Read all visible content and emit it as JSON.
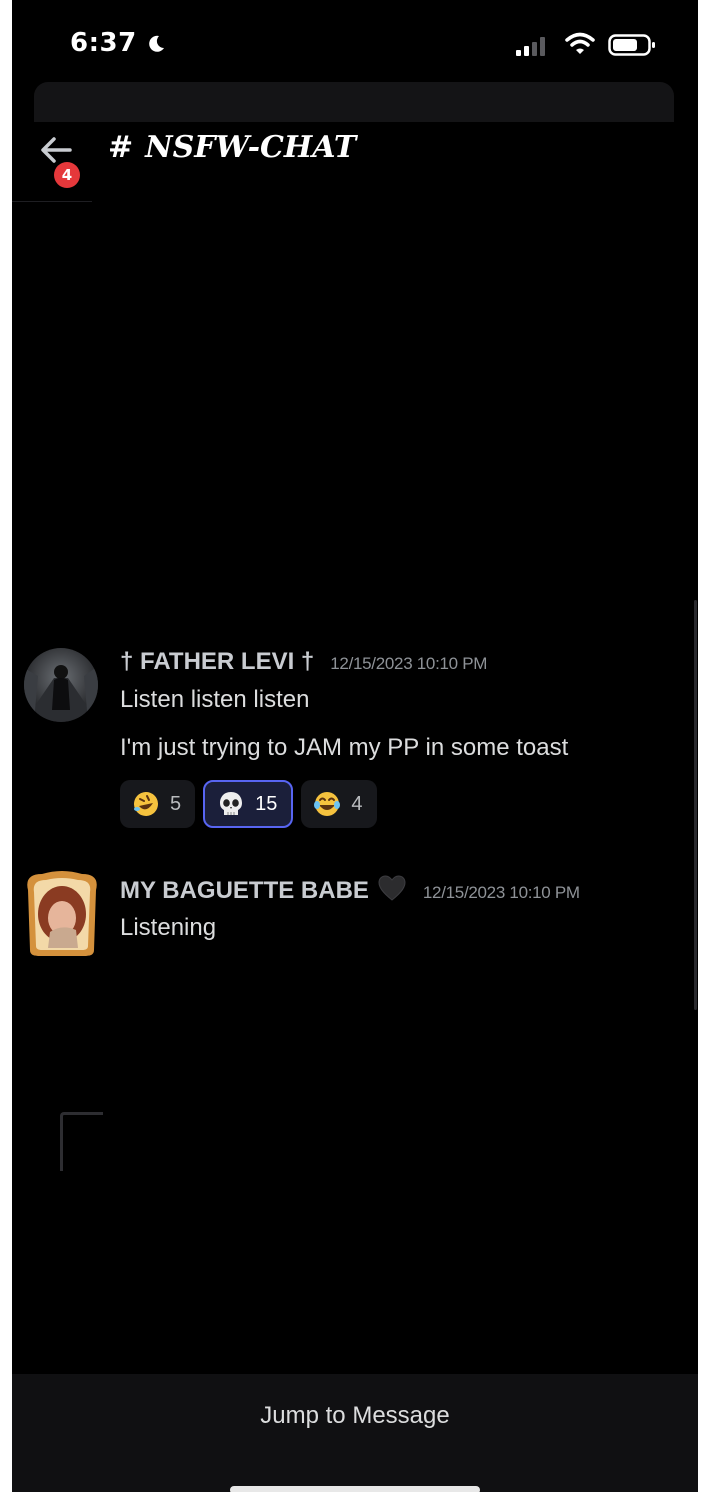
{
  "status_bar": {
    "time": "6:37",
    "icons": [
      "moon-icon",
      "signal-icon",
      "wifi-icon",
      "battery-icon"
    ]
  },
  "header": {
    "back_badge_count": "4",
    "channel_hash": "#",
    "channel_name": "NSFW-CHAT"
  },
  "messages": [
    {
      "author": "† FATHER LEVI †",
      "timestamp": "12/15/2023 10:10 PM",
      "lines": [
        "Listen listen listen",
        "I'm just trying to JAM my PP in some toast"
      ],
      "reactions": [
        {
          "emoji": "rolling-on-floor-laughing-icon",
          "count": "5",
          "active": false
        },
        {
          "emoji": "skull-icon",
          "count": "15",
          "active": true
        },
        {
          "emoji": "tears-of-joy-icon",
          "count": "4",
          "active": false
        }
      ]
    },
    {
      "author": "MY BAGUETTE BABE",
      "author_icon": "black-heart-icon",
      "timestamp": "12/15/2023 10:10 PM",
      "lines": [
        "Listening"
      ]
    }
  ],
  "footer": {
    "jump_label": "Jump to Message"
  },
  "colors": {
    "background": "#000000",
    "badge": "#e5383b",
    "active_reaction_border": "#5865f2",
    "username": "#c9ccd1",
    "timestamp": "#8e9297"
  }
}
